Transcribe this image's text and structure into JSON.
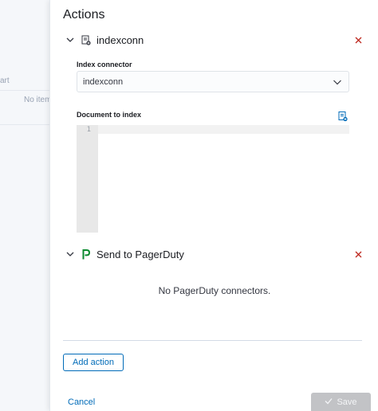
{
  "background": {
    "partial_label": "art",
    "empty_text": "No item"
  },
  "flyout": {
    "title": "Actions",
    "actions": [
      {
        "title": "indexconn",
        "icon": "index-document-icon",
        "connector_label": "Index connector",
        "connector_value": "indexconn",
        "document_label": "Document to index",
        "editor_line_numbers": [
          "1"
        ]
      },
      {
        "title": "Send to PagerDuty",
        "icon": "pagerduty-icon",
        "empty_text": "No PagerDuty connectors."
      }
    ],
    "add_action_label": "Add action",
    "cancel_label": "Cancel",
    "save_label": "Save"
  },
  "colors": {
    "accent": "#006bb8",
    "danger": "#bd271e",
    "pagerduty": "#0a8a2e",
    "disabled": "#c2c3c6"
  }
}
